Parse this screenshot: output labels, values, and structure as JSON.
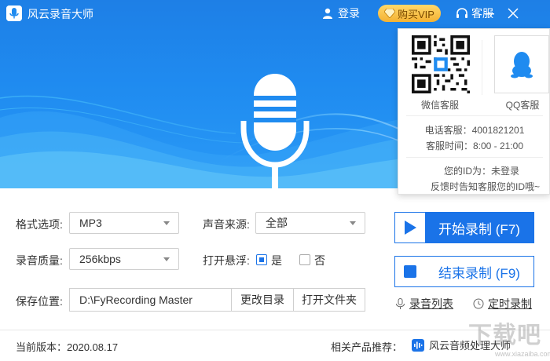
{
  "app": {
    "title": "风云录音大师",
    "login_label": "登录",
    "vip_label": "购买VIP",
    "service_label": "客服"
  },
  "service_panel": {
    "wechat_label": "微信客服",
    "qq_label": "QQ客服",
    "phone_text": "电话客服：4001821201",
    "hours_text": "客服时间：8:00 - 21:00",
    "id_text": "您的ID为：未登录",
    "feedback_text": "反馈时告知客服您的ID哦~"
  },
  "form": {
    "format_label": "格式选项:",
    "format_value": "MP3",
    "source_label": "声音来源:",
    "source_value": "全部",
    "quality_label": "录音质量:",
    "quality_value": "256kbps",
    "float_label": "打开悬浮:",
    "float_yes": "是",
    "float_no": "否",
    "float_selected": "是",
    "save_label": "保存位置:",
    "save_path": "D:\\FyRecording Master",
    "change_dir": "更改目录",
    "open_folder": "打开文件夹"
  },
  "actions": {
    "start_label": "开始录制 (F7)",
    "stop_label": "结束录制 (F9)",
    "recording_list": "录音列表",
    "timed_recording": "定时录制"
  },
  "footer": {
    "version": "当前版本：2020.08.17",
    "related_label": "相关产品推荐：",
    "related_product": "风云音频处理大师"
  },
  "watermark": {
    "text": "下载吧",
    "sub": "www.xiazaiba.com"
  },
  "colors": {
    "banner": "#1f8bf0",
    "accent": "#1a73e8",
    "vip": "#f4b233"
  }
}
